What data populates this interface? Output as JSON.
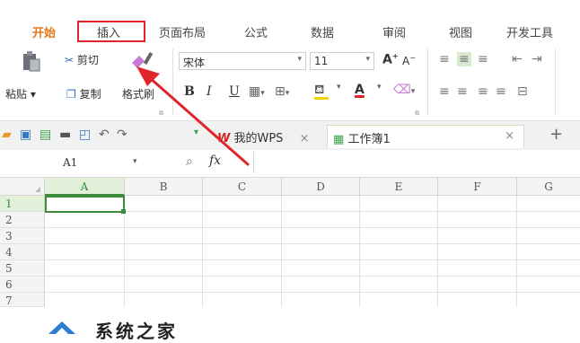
{
  "tabs": [
    "开始",
    "插入",
    "页面布局",
    "公式",
    "数据",
    "审阅",
    "视图",
    "开发工具"
  ],
  "clipboard": {
    "cut_label": "剪切",
    "copy_label": "复制",
    "paste_label": "粘贴",
    "format_painter_label": "格式刷"
  },
  "font": {
    "name": "宋体",
    "size": "11",
    "bold": "B",
    "italic": "I",
    "underline": "U",
    "grow": "A",
    "shrink": "A",
    "color_letter": "A"
  },
  "document_tabs": {
    "wps_label": "我的WPS",
    "workbook_label": "工作簿1",
    "close_symbol": "×",
    "new_symbol": "+"
  },
  "formula_bar": {
    "cell_ref": "A1",
    "fx_label": "fx"
  },
  "columns": [
    "A",
    "B",
    "C",
    "D",
    "E",
    "F",
    "G"
  ],
  "rows": [
    "1",
    "2",
    "3",
    "4",
    "5",
    "6",
    "7"
  ],
  "watermark": {
    "text": "系统之家"
  },
  "colors": {
    "active_tab": "#e07a1c",
    "highlight_box": "#e0262a",
    "arrow": "#e0262a",
    "active_cell_border": "#3d8c3a",
    "wps_logo": "#d0261c"
  }
}
